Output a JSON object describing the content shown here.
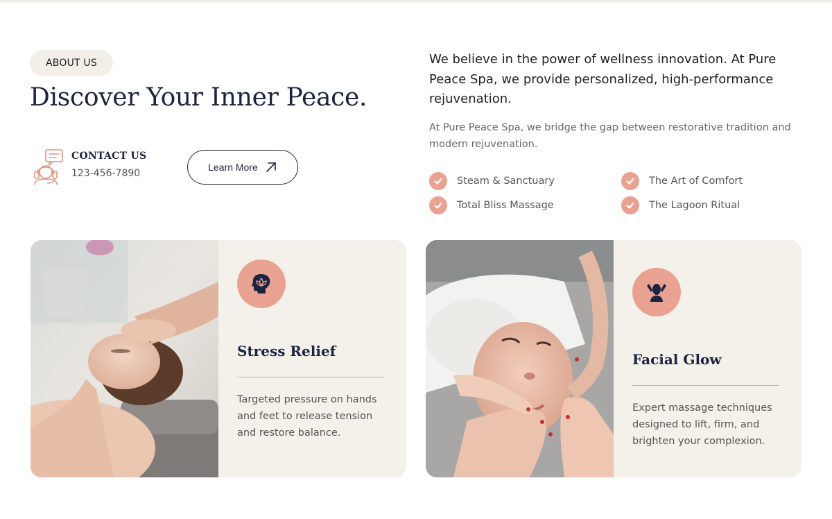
{
  "about": {
    "badge": "ABOUT US",
    "title": "Discover Your Inner Peace.",
    "contact_label": "CONTACT US",
    "contact_phone": "123-456-7890",
    "learn_more": "Learn More"
  },
  "intro": {
    "lead": "We believe in the power of wellness innovation. At Pure Peace Spa, we provide personalized, high-performance rejuvenation.",
    "sub": "At Pure Peace Spa, we bridge the gap between restorative tradition and modern rejuvenation."
  },
  "features": [
    "Steam & Sanctuary",
    "The Art of Comfort",
    "Total Bliss Massage",
    "The Lagoon Ritual"
  ],
  "cards": [
    {
      "icon": "head-lotus-icon",
      "title": "Stress Relief",
      "description": "Targeted pressure on hands and feet to release tension and restore balance."
    },
    {
      "icon": "face-massage-icon",
      "title": "Facial Glow",
      "description": "Expert massage techniques designed to lift, firm, and brighten your complexion."
    }
  ],
  "colors": {
    "accent": "#e9a291",
    "navy": "#1c2340",
    "card_bg": "#f4f1ea",
    "badge_bg": "#f3efe8"
  }
}
